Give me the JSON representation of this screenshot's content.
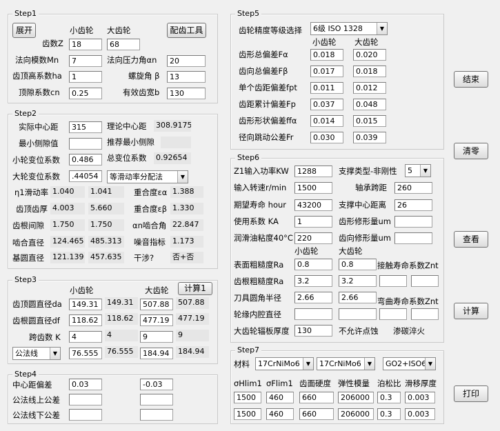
{
  "step1": {
    "title": "Step1",
    "expand_label": "展开",
    "tool_label": "配齿工具",
    "col_small": "小齿轮",
    "col_large": "大齿轮",
    "teeth_label": "齿数Z",
    "teeth_small": "18",
    "teeth_large": "68",
    "module_label": "法向模数Mn",
    "module_val": "7",
    "pressure_label": "法向压力角αn",
    "pressure_val": "20",
    "addendum_label": "齿顶高系数ha",
    "addendum_val": "1",
    "helix_label": "螺旋角 β",
    "helix_val": "13",
    "clearance_label": "顶隙系数cn",
    "clearance_val": "0.25",
    "facewidth_label": "有效齿宽b",
    "facewidth_val": "130"
  },
  "step2": {
    "title": "Step2",
    "actual_cd_label": "实际中心距",
    "actual_cd_val": "315",
    "theo_cd_label": "理论中心距",
    "theo_cd_val": "308.9175",
    "min_bl_label": "最小侧隙值",
    "min_bl_val": "",
    "rec_bl_label": "推荐最小侧隙",
    "rec_bl_val": "",
    "x1_label": "小轮变位系数",
    "x1_val": "0.486",
    "xsum_label": "总变位系数",
    "xsum_val": "0.92654",
    "x2_label": "大轮变位系数",
    "x2_val": ".44054",
    "dist_method": "等滑动率分配法",
    "slip_label": "η1滑动率",
    "slip_small": "1.040",
    "slip_large": "1.041",
    "ea_label": "重合度εα",
    "ea_val": "1.388",
    "tip_th_label": "齿顶齿厚",
    "tip_th_small": "4.003",
    "tip_th_large": "5.660",
    "eb_label": "重合度εβ",
    "eb_val": "1.330",
    "root_cl_label": "齿根间隙",
    "root_cl_small": "1.750",
    "root_cl_large": "1.750",
    "alpha_label": "αn啮合角",
    "alpha_val": "22.847",
    "mesh_d_label": "啮合直径",
    "mesh_d_small": "124.465",
    "mesh_d_large": "485.313",
    "noise_label": "噪音指标",
    "noise_val": "1.173",
    "base_d_label": "基圆直径",
    "base_d_small": "121.139",
    "base_d_large": "457.635",
    "interf_label": "干涉?",
    "interf_val": "否+否"
  },
  "step3": {
    "title": "Step3",
    "col_small": "小齿轮",
    "col_large": "大齿轮",
    "calc_label": "计算1",
    "tip_d_label": "齿顶圆直径da",
    "tip_d_small": "149.31",
    "tip_d_small_ro": "149.31",
    "tip_d_large": "507.88",
    "tip_d_large_ro": "507.88",
    "root_d_label": "齿根圆直径df",
    "root_d_small": "118.62",
    "root_d_small_ro": "118.62",
    "root_d_large": "477.19",
    "root_d_large_ro": "477.19",
    "span_label": "跨齿数 K",
    "span_small": "4",
    "span_small_ro": "4",
    "span_large": "9",
    "span_large_ro": "9",
    "mode": "公法线",
    "wk_small": "76.555",
    "wk_small_ro": "76.555",
    "wk_large": "184.94",
    "wk_large_ro": "184.94"
  },
  "step4": {
    "title": "Step4",
    "cd_dev_label": "中心距偏差",
    "cd_dev_up": "0.03",
    "cd_dev_low": "-0.03",
    "wk_up_label": "公法线上公差",
    "wk_low_label": "公法线下公差"
  },
  "step5": {
    "title": "Step5",
    "grade_label": "齿轮精度等级选择",
    "grade_val": "6级 ISO 1328",
    "col_small": "小齿轮",
    "col_large": "大齿轮",
    "rows": [
      {
        "label": "齿形总偏差Fα",
        "small": "0.018",
        "large": "0.020"
      },
      {
        "label": "齿向总偏差Fβ",
        "small": "0.017",
        "large": "0.018"
      },
      {
        "label": "单个齿距偏差fpt",
        "small": "0.011",
        "large": "0.012"
      },
      {
        "label": "齿距累计偏差Fp",
        "small": "0.037",
        "large": "0.048"
      },
      {
        "label": "齿形形状偏差ffα",
        "small": "0.014",
        "large": "0.015"
      },
      {
        "label": "径向跳动公差Fr",
        "small": "0.030",
        "large": "0.039"
      }
    ]
  },
  "step6": {
    "title": "Step6",
    "power_label": "Z1输入功率KW",
    "power_val": "1288",
    "support_label": "支撑类型-非刚性",
    "support_val": "5",
    "speed_label": "输入转速r/min",
    "speed_val": "1500",
    "span_label": "轴承跨距",
    "span_val": "260",
    "life_label": "期望寿命 hour",
    "life_val": "43200",
    "center_label": "支撑中心距离",
    "center_val": "26",
    "ka_label": "使用系数 KA",
    "ka_val": "1",
    "profmod_label": "齿形修形量um",
    "profmod_val": "",
    "visc_label": "润滑油粘度40°C",
    "visc_val": "220",
    "leadmod_label": "齿向修形量um",
    "leadmod_val": "",
    "col_small": "小齿轮",
    "col_large": "大齿轮",
    "ra_label": "表面粗糙度Ra",
    "ra_small": "0.8",
    "ra_large": "0.8",
    "znt_label": "接触寿命系数Znt",
    "rr_label": "齿根粗糙度Ra",
    "rr_small": "3.2",
    "rr_large": "3.2",
    "tool_label": "刀具圆角半径",
    "tool_small": "2.66",
    "tool_large": "2.66",
    "bend_label": "弯曲寿命系数Znt",
    "rim_label": "轮缘内腔直径",
    "web_label": "大齿轮辐板厚度",
    "web_val": "130",
    "pit_label": "不允许点蚀",
    "carb_label": "渗碳淬火"
  },
  "step7": {
    "title": "Step7",
    "mat_label": "材料",
    "mat1": "17CrNiMo6",
    "mat2": "17CrNiMo6",
    "std": "GO2+ISO633",
    "headers": [
      "σHlim1",
      "σFlim1",
      "齿面硬度",
      "弹性模量",
      "泊松比",
      "滑移厚度"
    ],
    "row1": [
      "1500",
      "460",
      "660",
      "206000",
      "0.3",
      "0.003"
    ],
    "row2": [
      "1500",
      "460",
      "660",
      "206000",
      "0.3",
      "0.003"
    ]
  },
  "actions": {
    "finish": "结束",
    "clear": "清零",
    "view": "查看",
    "calc": "计算",
    "print": "打印"
  }
}
